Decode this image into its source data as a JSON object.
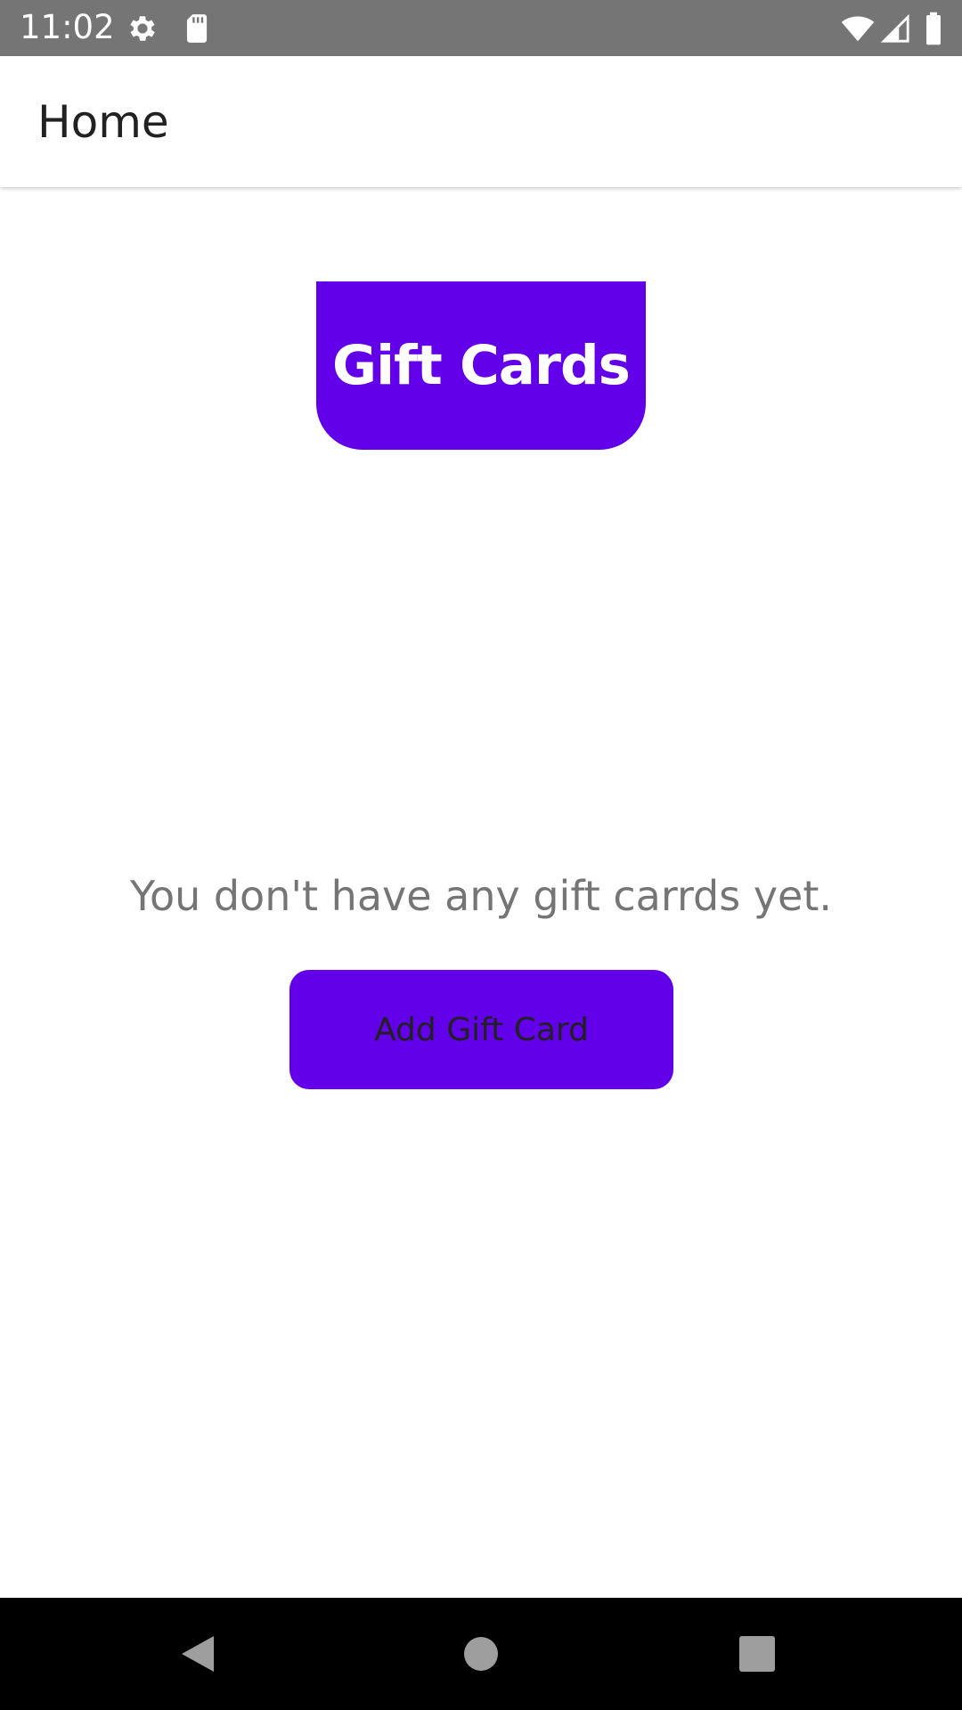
{
  "status_bar": {
    "time": "11:02",
    "icons": [
      "gear-icon",
      "sd-card-icon",
      "wifi-icon",
      "signal-icon",
      "battery-icon"
    ]
  },
  "app_bar": {
    "title": "Home"
  },
  "header": {
    "title": "Gift Cards"
  },
  "empty_state": {
    "message": "You don't have any gift carrds yet."
  },
  "actions": {
    "add_label": "Add Gift Card"
  },
  "nav_bar": {
    "icons": [
      "back-icon",
      "home-icon",
      "recent-apps-icon"
    ]
  },
  "colors": {
    "accent": "#6200ea",
    "status_bar": "#757575",
    "nav_bar": "#000000"
  }
}
